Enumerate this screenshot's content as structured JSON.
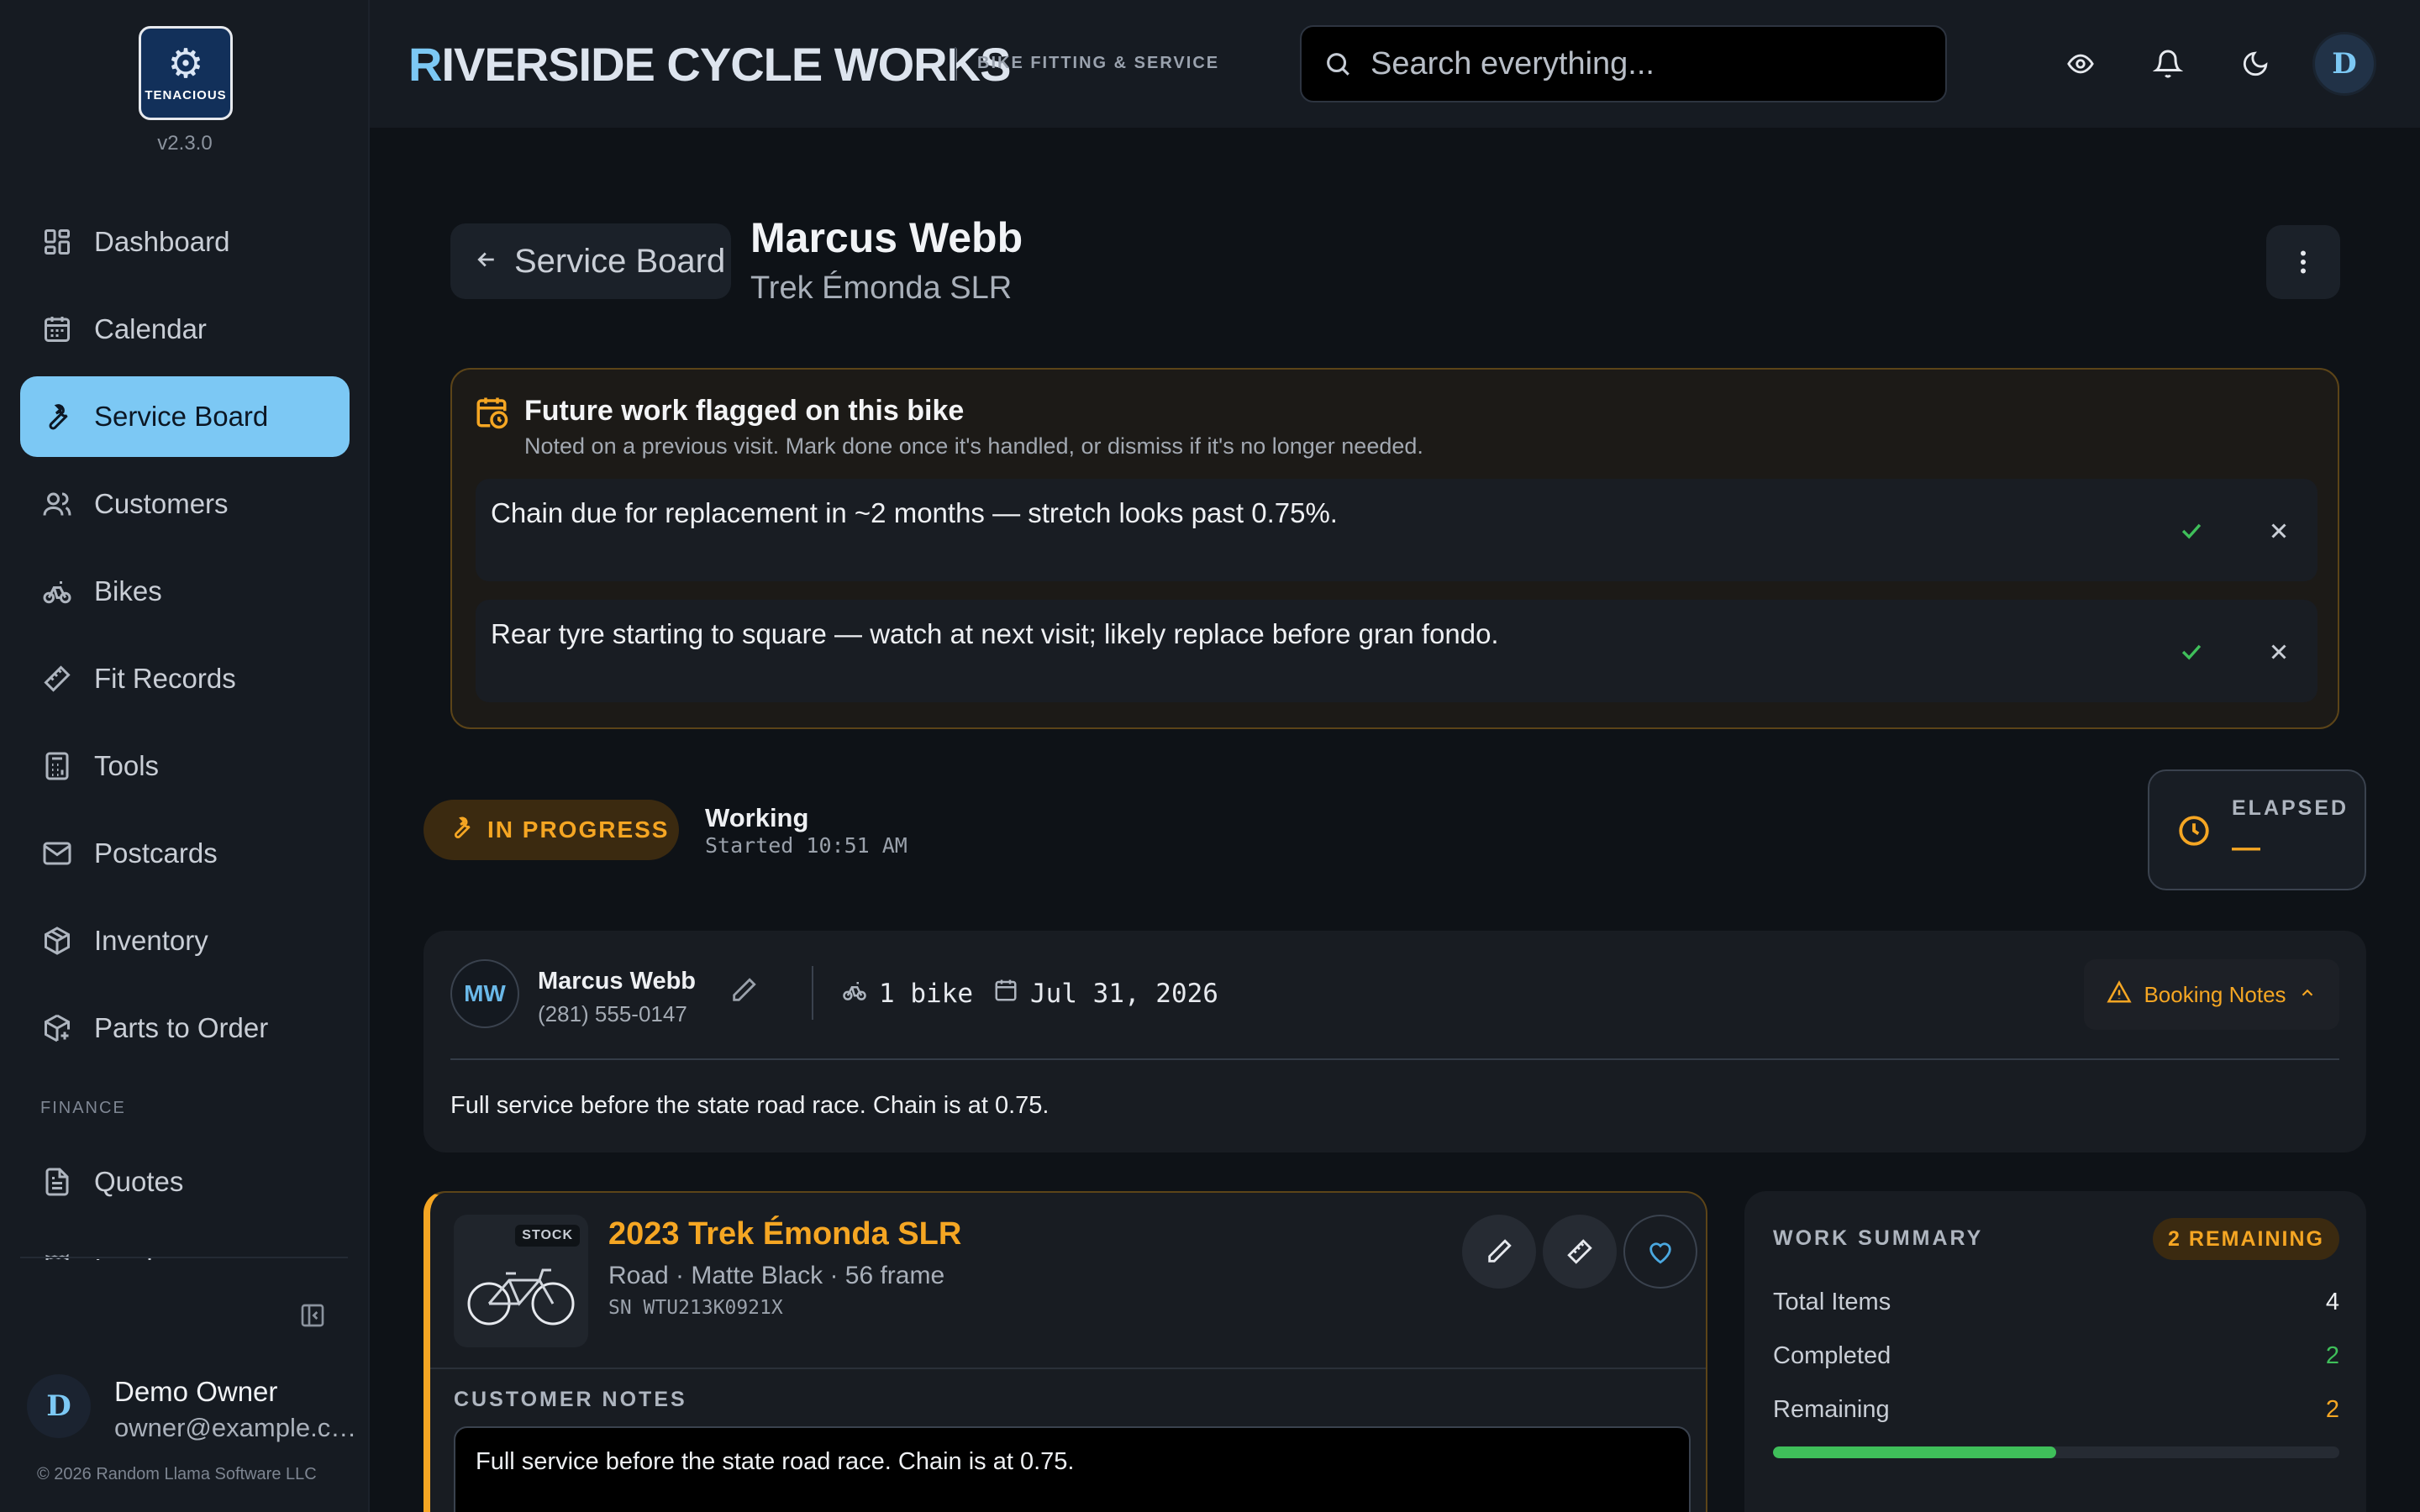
{
  "app": {
    "title_first": "R",
    "title_rest": "IVERSIDE CYCLE WORKS",
    "subtitle": "BIKE FITTING & SERVICE",
    "version": "v2.3.0",
    "logo_text": "TENACIOUS"
  },
  "search": {
    "placeholder": "Search everything..."
  },
  "topbar": {
    "avatar_initial": "D"
  },
  "sidebar": {
    "items": [
      {
        "label": "Dashboard",
        "icon": "grid-icon"
      },
      {
        "label": "Calendar",
        "icon": "calendar-icon"
      },
      {
        "label": "Service Board",
        "icon": "wrench-icon",
        "active": true
      },
      {
        "label": "Customers",
        "icon": "users-icon"
      },
      {
        "label": "Bikes",
        "icon": "bike-icon"
      },
      {
        "label": "Fit Records",
        "icon": "ruler-icon"
      },
      {
        "label": "Tools",
        "icon": "calculator-icon"
      },
      {
        "label": "Postcards",
        "icon": "mail-icon"
      },
      {
        "label": "Inventory",
        "icon": "box-icon"
      },
      {
        "label": "Parts to Order",
        "icon": "package-plus-icon"
      }
    ],
    "finance_section": "FINANCE",
    "finance_items": [
      {
        "label": "Quotes",
        "icon": "document-icon"
      },
      {
        "label": "Invoices",
        "icon": "invoice-icon"
      }
    ],
    "user": {
      "initial": "D",
      "name": "Demo Owner",
      "email": "owner@example.com"
    },
    "copyright": "© 2026 Random Llama Software LLC"
  },
  "header": {
    "back_label": "Service Board",
    "customer_name": "Marcus Webb",
    "bike_name": "Trek Émonda SLR"
  },
  "flags": {
    "title": "Future work flagged on this bike",
    "description": "Noted on a previous visit. Mark done once it's handled, or dismiss if it's no longer needed.",
    "items": [
      {
        "text": "Chain due for replacement in ~2 months — stretch looks past 0.75%."
      },
      {
        "text": "Rear tyre starting to square — watch at next visit; likely replace before gran fondo."
      }
    ]
  },
  "status": {
    "label": "IN PROGRESS",
    "state": "Working",
    "started": "Started 10:51 AM",
    "elapsed_label": "ELAPSED",
    "elapsed_value": "—"
  },
  "customer_card": {
    "initials": "MW",
    "name": "Marcus Webb",
    "phone": "(281) 555-0147",
    "bikes": "1 bike",
    "date": "Jul 31, 2026",
    "booking_notes_label": "Booking Notes",
    "note": "Full service before the state road race. Chain is at 0.75."
  },
  "bike_card": {
    "stock_badge": "STOCK",
    "title": "2023 Trek Émonda SLR",
    "spec": "Road · Matte Black · 56 frame",
    "serial": "SN WTU213K0921X",
    "customer_notes_label": "CUSTOMER NOTES",
    "customer_notes": "Full service before the state road race. Chain is at 0.75."
  },
  "work_summary": {
    "title": "WORK SUMMARY",
    "badge": "2 REMAINING",
    "rows": [
      {
        "label": "Total Items",
        "value": "4"
      },
      {
        "label": "Completed",
        "value": "2"
      },
      {
        "label": "Remaining",
        "value": "2"
      }
    ],
    "progress_fraction": 0.5
  },
  "colors": {
    "accent": "#7cc8f4",
    "warning": "#f5a623",
    "success": "#3fbf5a",
    "background": "#0e1217"
  }
}
